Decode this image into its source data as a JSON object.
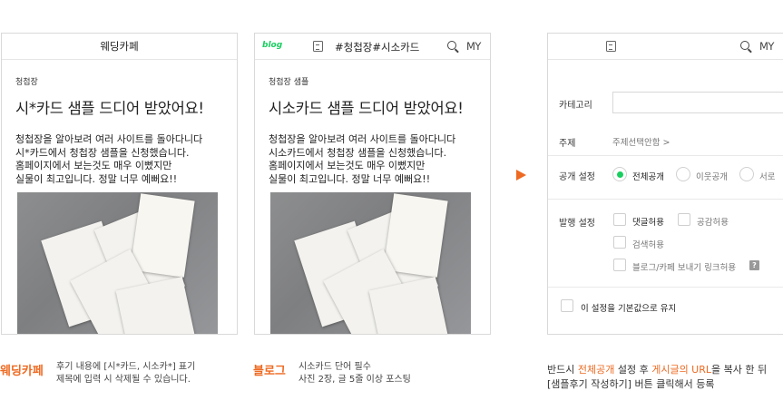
{
  "cafe_panel": {
    "header_title": "웨딩카페",
    "category": "청첩장",
    "post_title": "시*카드 샘플 드디어 받았어요!",
    "body": "청첩장을 알아보려 여러 사이트를 돌아다니다\n시*카드에서 청첩장 샘플을 신청했습니다.\n홈페이지에서 보는것도 매우 이뻤지만\n실물이 최고입니다. 정말 너무 예뻐요!!",
    "caption_label": "웨딩카페",
    "caption_line1": "후기 내용에 [시*카드, 시소카*] 표기",
    "caption_line2": "제목에 입력 시 삭제될 수 있습니다."
  },
  "blog_panel": {
    "logo_text": "blog",
    "header_title": "#청첩장#시소카드",
    "my_label": "MY",
    "category": "청첩장 샘플",
    "post_title": "시소카드 샘플 드디어 받았어요!",
    "body": "청첩장을 알아보려 여러 사이트를 돌아다니다\n시소카드에서 청첩장 샘플을 신청했습니다.\n홈페이지에서 보는것도 매우 이뻤지만\n실물이 최고입니다. 정말 너무 예뻐요!!",
    "caption_label": "블로그",
    "caption_line1": "시소카드 단어 필수",
    "caption_line2": "사진 2장, 글 5줄 이상 포스팅"
  },
  "settings_panel": {
    "my_label": "MY",
    "category_label": "카테고리",
    "category_value": "",
    "topic_label": "주제",
    "topic_value": "주제선택안함 >",
    "visibility_label": "공개 설정",
    "visibility_options": [
      "전체공개",
      "이웃공개",
      "서로"
    ],
    "visibility_selected": "전체공개",
    "publish_label": "발행 설정",
    "publish_options": {
      "comments": "댓글허용",
      "likes": "공감허용",
      "search": "검색허용",
      "share_link": "블로그/카페 보내기 링크허용"
    },
    "help_icon_text": "?",
    "save_default": "이 설정을 기본값으로 유지"
  },
  "footer_note": {
    "line1_pre": "반드시 ",
    "line1_hl1": "전체공개",
    "line1_mid": " 설정 후 ",
    "line1_hl2": "게시글의 URL",
    "line1_post": "을 복사 한 뒤",
    "line2": "[샘플후기 작성하기] 버튼 클릭해서 등록"
  },
  "colors": {
    "accent": "#ee6a22",
    "blog_green": "#19ce60"
  }
}
